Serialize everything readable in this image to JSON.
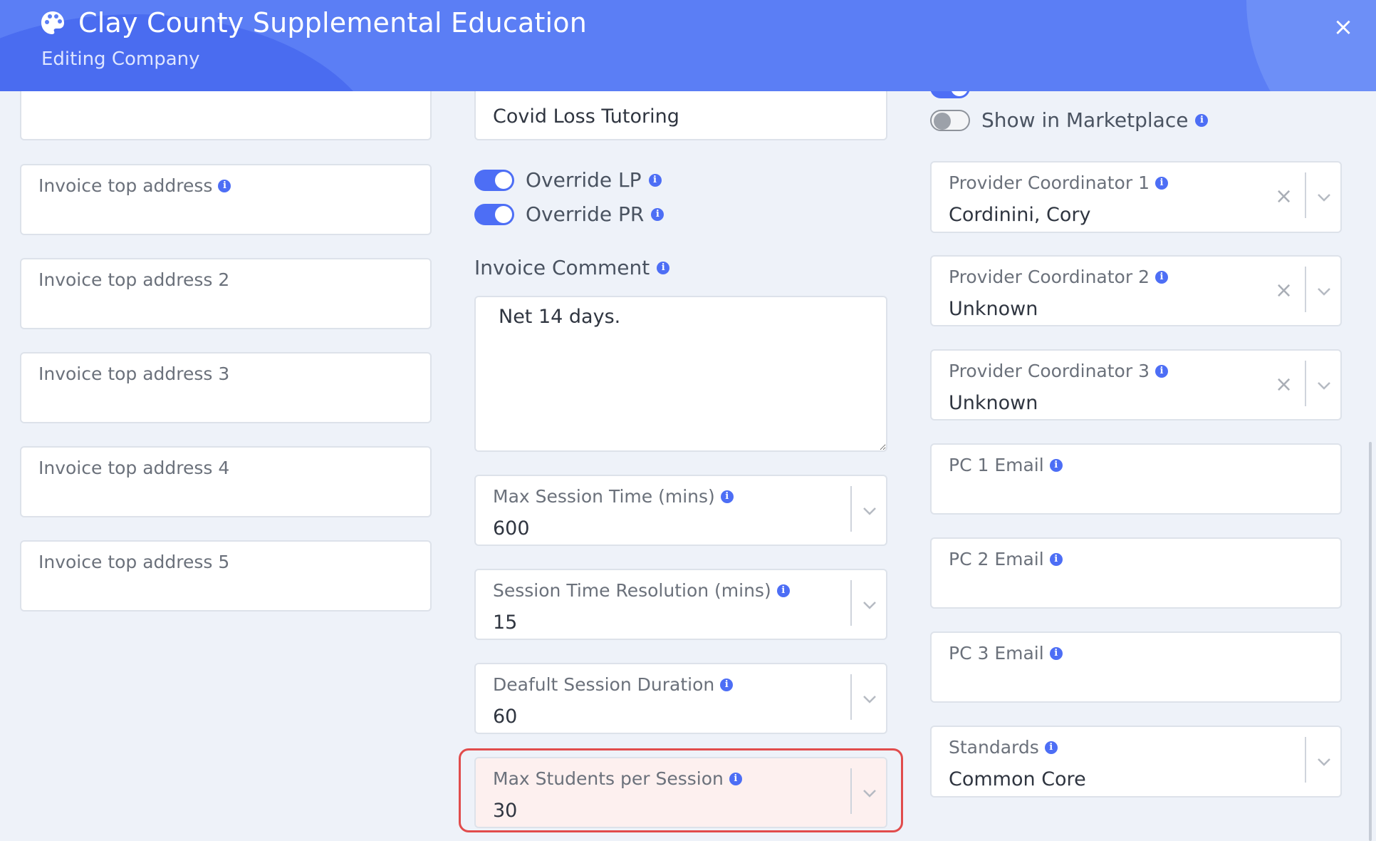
{
  "header": {
    "title": "Clay County Supplemental Education",
    "subtitle": "Editing Company",
    "icon": "palette-icon",
    "close_label": "×"
  },
  "left": {
    "top_field_partial": {
      "value": ""
    },
    "invoice_fields": [
      {
        "label": "Invoice top address",
        "value": "",
        "has_info": true
      },
      {
        "label": "Invoice top address 2",
        "value": ""
      },
      {
        "label": "Invoice top address 3",
        "value": ""
      },
      {
        "label": "Invoice top address 4",
        "value": ""
      },
      {
        "label": "Invoice top address 5",
        "value": ""
      }
    ]
  },
  "middle": {
    "top_field_partial": {
      "value": "Covid Loss Tutoring"
    },
    "toggles": [
      {
        "label": "Override LP",
        "on": true
      },
      {
        "label": "Override PR",
        "on": true
      }
    ],
    "invoice_comment": {
      "label": "Invoice Comment",
      "value": "Net 14 days."
    },
    "selects": [
      {
        "label": "Max Session Time (mins)",
        "value": "600"
      },
      {
        "label": "Session Time Resolution (mins)",
        "value": "15"
      },
      {
        "label": "Deafult Session Duration",
        "value": "60"
      },
      {
        "label": "Max Students per Session",
        "value": "30"
      }
    ]
  },
  "right": {
    "toggles": [
      {
        "label": "Show in Marketplace",
        "on": false
      }
    ],
    "coordinators": [
      {
        "label": "Provider Coordinator 1",
        "value": "Cordinini, Cory"
      },
      {
        "label": "Provider Coordinator 2",
        "value": "Unknown"
      },
      {
        "label": "Provider Coordinator 3",
        "value": "Unknown"
      }
    ],
    "emails": [
      {
        "label": "PC 1 Email",
        "value": ""
      },
      {
        "label": "PC 2 Email",
        "value": ""
      },
      {
        "label": "PC 3 Email",
        "value": ""
      }
    ],
    "standards": {
      "label": "Standards",
      "value": "Common Core"
    }
  },
  "colors": {
    "header": "#5b7ef5",
    "accent": "#4d6ef5",
    "highlight": "#e14c4c"
  }
}
